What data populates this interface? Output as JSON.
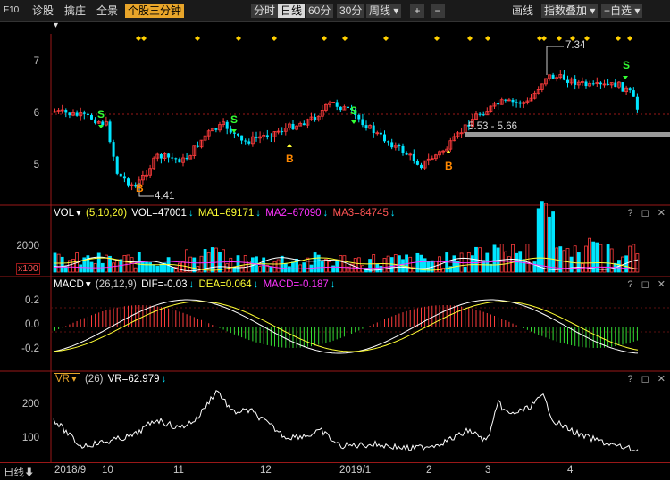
{
  "toolbar": {
    "f10": "F10",
    "diagnose": "诊股",
    "select": "擒庄",
    "panorama": "全景",
    "stock_3min": "个股三分钟",
    "periods": [
      "分时",
      "日线",
      "60分",
      "30分"
    ],
    "active_period": "日线",
    "week": "周线",
    "plus": "+",
    "minus": "−",
    "draw": "画线",
    "index_overlay": "指数叠加",
    "self_select": "+自选"
  },
  "price_panel": {
    "y_ticks": [
      "7",
      "6",
      "5"
    ],
    "high_label": "7.34",
    "low_label": "4.41",
    "range_label": "5.53 - 5.66",
    "signals": [
      "S",
      "S",
      "S",
      "S",
      "B",
      "B",
      "B"
    ]
  },
  "vol_panel": {
    "name": "VOL",
    "params": "(5,10,20)",
    "vol": "VOL=47001",
    "ma1": "MA1=69171",
    "ma2": "MA2=67090",
    "ma3": "MA3=84745",
    "y_tick": "2000",
    "unit": "x100",
    "controls": "? ◻ ✕"
  },
  "macd_panel": {
    "name": "MACD",
    "params": "(26,12,9)",
    "dif": "DIF=-0.03",
    "dea": "DEA=0.064",
    "macd": "MACD=-0.187",
    "y_ticks": [
      "0.2",
      "0.0",
      "-0.2"
    ],
    "controls": "? ◻ ✕"
  },
  "vr_panel": {
    "name": "VR",
    "params": "(26)",
    "vr": "VR=62.979",
    "y_ticks": [
      "200",
      "100"
    ],
    "controls": "? ◻ ✕"
  },
  "date_axis": {
    "period": "日线",
    "labels": [
      "2018/9",
      "10",
      "11",
      "12",
      "2019/1",
      "2",
      "3",
      "4"
    ]
  },
  "colors": {
    "up": "#ff3c3c",
    "down": "#00e5ff",
    "accent": "#e8a52a",
    "ma_white": "#ffffff",
    "ma_yellow": "#ffff33",
    "ma_magenta": "#ff33ff"
  }
}
